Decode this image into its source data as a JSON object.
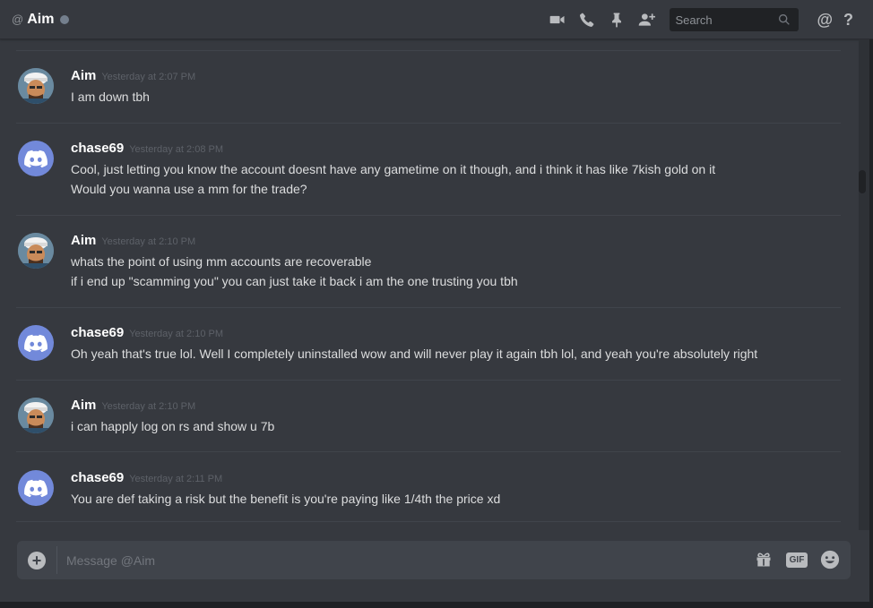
{
  "header": {
    "at_symbol": "@",
    "channel_name": "Aim",
    "status": "offline",
    "icons": [
      "video-call-icon",
      "voice-call-icon",
      "pin-icon",
      "add-friend-icon"
    ],
    "search_placeholder": "Search",
    "mention_symbol": "@",
    "help_symbol": "?"
  },
  "messages": [
    {
      "author": "Aim",
      "avatar": "aim-avatar",
      "timestamp": "Yesterday at 2:07 PM",
      "lines": [
        "I am down tbh"
      ]
    },
    {
      "author": "chase69",
      "avatar": "discord-default-avatar",
      "timestamp": "Yesterday at 2:08 PM",
      "lines": [
        "Cool, just letting you know the account doesnt have any gametime on it though, and i think it has like 7kish gold on it",
        "Would you wanna use a mm for the trade?"
      ]
    },
    {
      "author": "Aim",
      "avatar": "aim-avatar",
      "timestamp": "Yesterday at 2:10 PM",
      "lines": [
        "whats the point of using mm accounts are recoverable",
        "if i end up \"scamming you\" you can just take it back i am the one trusting you tbh"
      ]
    },
    {
      "author": "chase69",
      "avatar": "discord-default-avatar",
      "timestamp": "Yesterday at 2:10 PM",
      "lines": [
        "Oh yeah that's true lol. Well I completely uninstalled wow and will never play it again tbh lol, and yeah you're absolutely right"
      ]
    },
    {
      "author": "Aim",
      "avatar": "aim-avatar",
      "timestamp": "Yesterday at 2:10 PM",
      "lines": [
        "i can happly log on rs and show u 7b"
      ]
    },
    {
      "author": "chase69",
      "avatar": "discord-default-avatar",
      "timestamp": "Yesterday at 2:11 PM",
      "lines": [
        "You are def taking a risk but the benefit is you're paying like 1/4th the price xd"
      ]
    }
  ],
  "composer": {
    "plus_symbol": "+",
    "placeholder": "Message @Aim",
    "gif_label": "GIF",
    "icons": [
      "gift-icon",
      "gif-icon",
      "emoji-icon"
    ]
  },
  "colors": {
    "background": "#36393f",
    "discord_blurple": "#7289da",
    "username": "#ffffff",
    "text": "#dcddde",
    "timestamp": "#5d6168"
  }
}
